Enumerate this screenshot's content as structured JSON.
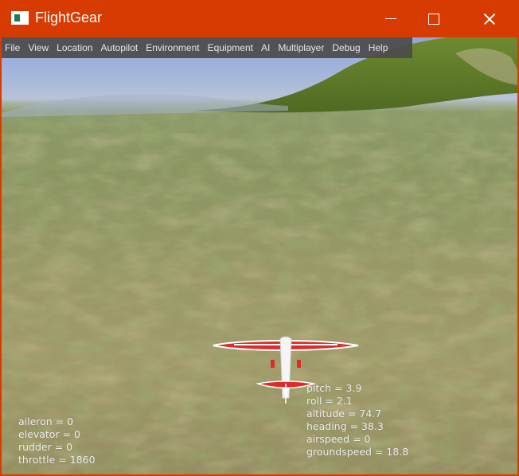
{
  "window": {
    "title": "FlightGear",
    "icon": "flightgear-app-icon",
    "accent_color": "#d83b01"
  },
  "menubar": {
    "items": [
      "File",
      "View",
      "Location",
      "Autopilot",
      "Environment",
      "Equipment",
      "AI",
      "Multiplayer",
      "Debug",
      "Help"
    ]
  },
  "hud_left": {
    "lines": [
      "aileron = 0",
      "elevator = 0",
      "rudder = 0",
      "throttle = 1860"
    ]
  },
  "hud_right": {
    "lines": [
      "pitch = 3.9",
      "roll = 2.1",
      "altitude = 74.7",
      "heading = 38.3",
      "airspeed = 0",
      "groundspeed = 18.8"
    ]
  },
  "scene": {
    "aircraft": "red-white-light-aircraft",
    "sky_color": "#8fa6d8",
    "terrain_color": "#9a9868",
    "hill_color": "#5f7a2a"
  }
}
